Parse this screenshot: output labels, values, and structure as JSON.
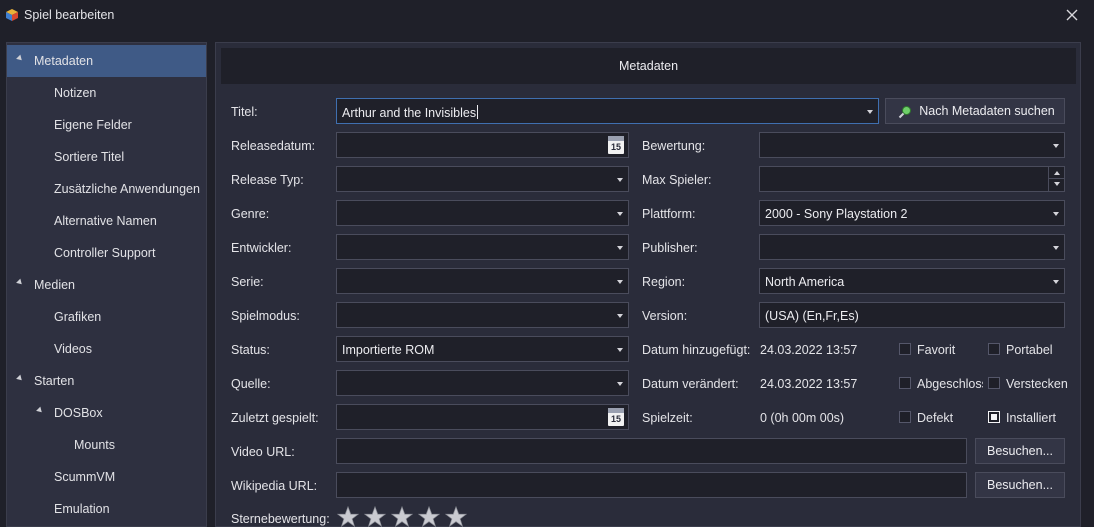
{
  "window": {
    "title": "Spiel bearbeiten"
  },
  "sidebar": {
    "items": [
      {
        "label": "Metadaten"
      },
      {
        "label": "Notizen"
      },
      {
        "label": "Eigene Felder"
      },
      {
        "label": "Sortiere Titel"
      },
      {
        "label": "Zusätzliche Anwendungen"
      },
      {
        "label": "Alternative Namen"
      },
      {
        "label": "Controller Support"
      },
      {
        "label": "Medien"
      },
      {
        "label": "Grafiken"
      },
      {
        "label": "Videos"
      },
      {
        "label": "Starten"
      },
      {
        "label": "DOSBox"
      },
      {
        "label": "Mounts"
      },
      {
        "label": "ScummVM"
      },
      {
        "label": "Emulation"
      }
    ]
  },
  "main": {
    "header": "Metadaten",
    "title_label": "Titel:",
    "title_value": "Arthur and the Invisibles",
    "search_button": "Nach Metadaten suchen",
    "releasedatum_label": "Releasedatum:",
    "releasedatum_value": "",
    "calendar_day": "15",
    "bewertung_label": "Bewertung:",
    "bewertung_value": "",
    "release_typ_label": "Release Typ:",
    "release_typ_value": "",
    "max_spieler_label": "Max Spieler:",
    "max_spieler_value": "",
    "genre_label": "Genre:",
    "genre_value": "",
    "plattform_label": "Plattform:",
    "plattform_value": "2000 - Sony Playstation 2",
    "entwickler_label": "Entwickler:",
    "entwickler_value": "",
    "publisher_label": "Publisher:",
    "publisher_value": "",
    "serie_label": "Serie:",
    "serie_value": "",
    "region_label": "Region:",
    "region_value": "North America",
    "spielmodus_label": "Spielmodus:",
    "spielmodus_value": "",
    "version_label": "Version:",
    "version_value": "(USA) (En,Fr,Es)",
    "status_label": "Status:",
    "status_value": "Importierte ROM",
    "datum_hinzugefuegt_label": "Datum hinzugefügt:",
    "datum_hinzugefuegt_value": "24.03.2022 13:57",
    "quelle_label": "Quelle:",
    "quelle_value": "",
    "datum_veraendert_label": "Datum verändert:",
    "datum_veraendert_value": "24.03.2022 13:57",
    "zuletzt_gespielt_label": "Zuletzt gespielt:",
    "zuletzt_gespielt_value": "",
    "spielzeit_label": "Spielzeit:",
    "spielzeit_value": "0 (0h 00m 00s)",
    "video_url_label": "Video URL:",
    "video_url_value": "",
    "wikipedia_url_label": "Wikipedia URL:",
    "wikipedia_url_value": "",
    "besuchen_label": "Besuchen...",
    "sternebewertung_label": "Sternebewertung:",
    "stars_filled": 0,
    "stars_total": 5
  },
  "checkboxes": {
    "favorit": {
      "label": "Favorit",
      "checked": false
    },
    "portabel": {
      "label": "Portabel",
      "checked": false
    },
    "abgeschlossen": {
      "label": "Abgeschloss",
      "checked": false
    },
    "verstecken": {
      "label": "Verstecken",
      "checked": false
    },
    "defekt": {
      "label": "Defekt",
      "checked": false
    },
    "installiert": {
      "label": "Installiert",
      "checked": true
    }
  },
  "colors": {
    "window_bg": "#1f2029",
    "panel_bg": "#2a2c3a",
    "selection": "#3f5a86",
    "focus_border": "#3f6fb0"
  }
}
